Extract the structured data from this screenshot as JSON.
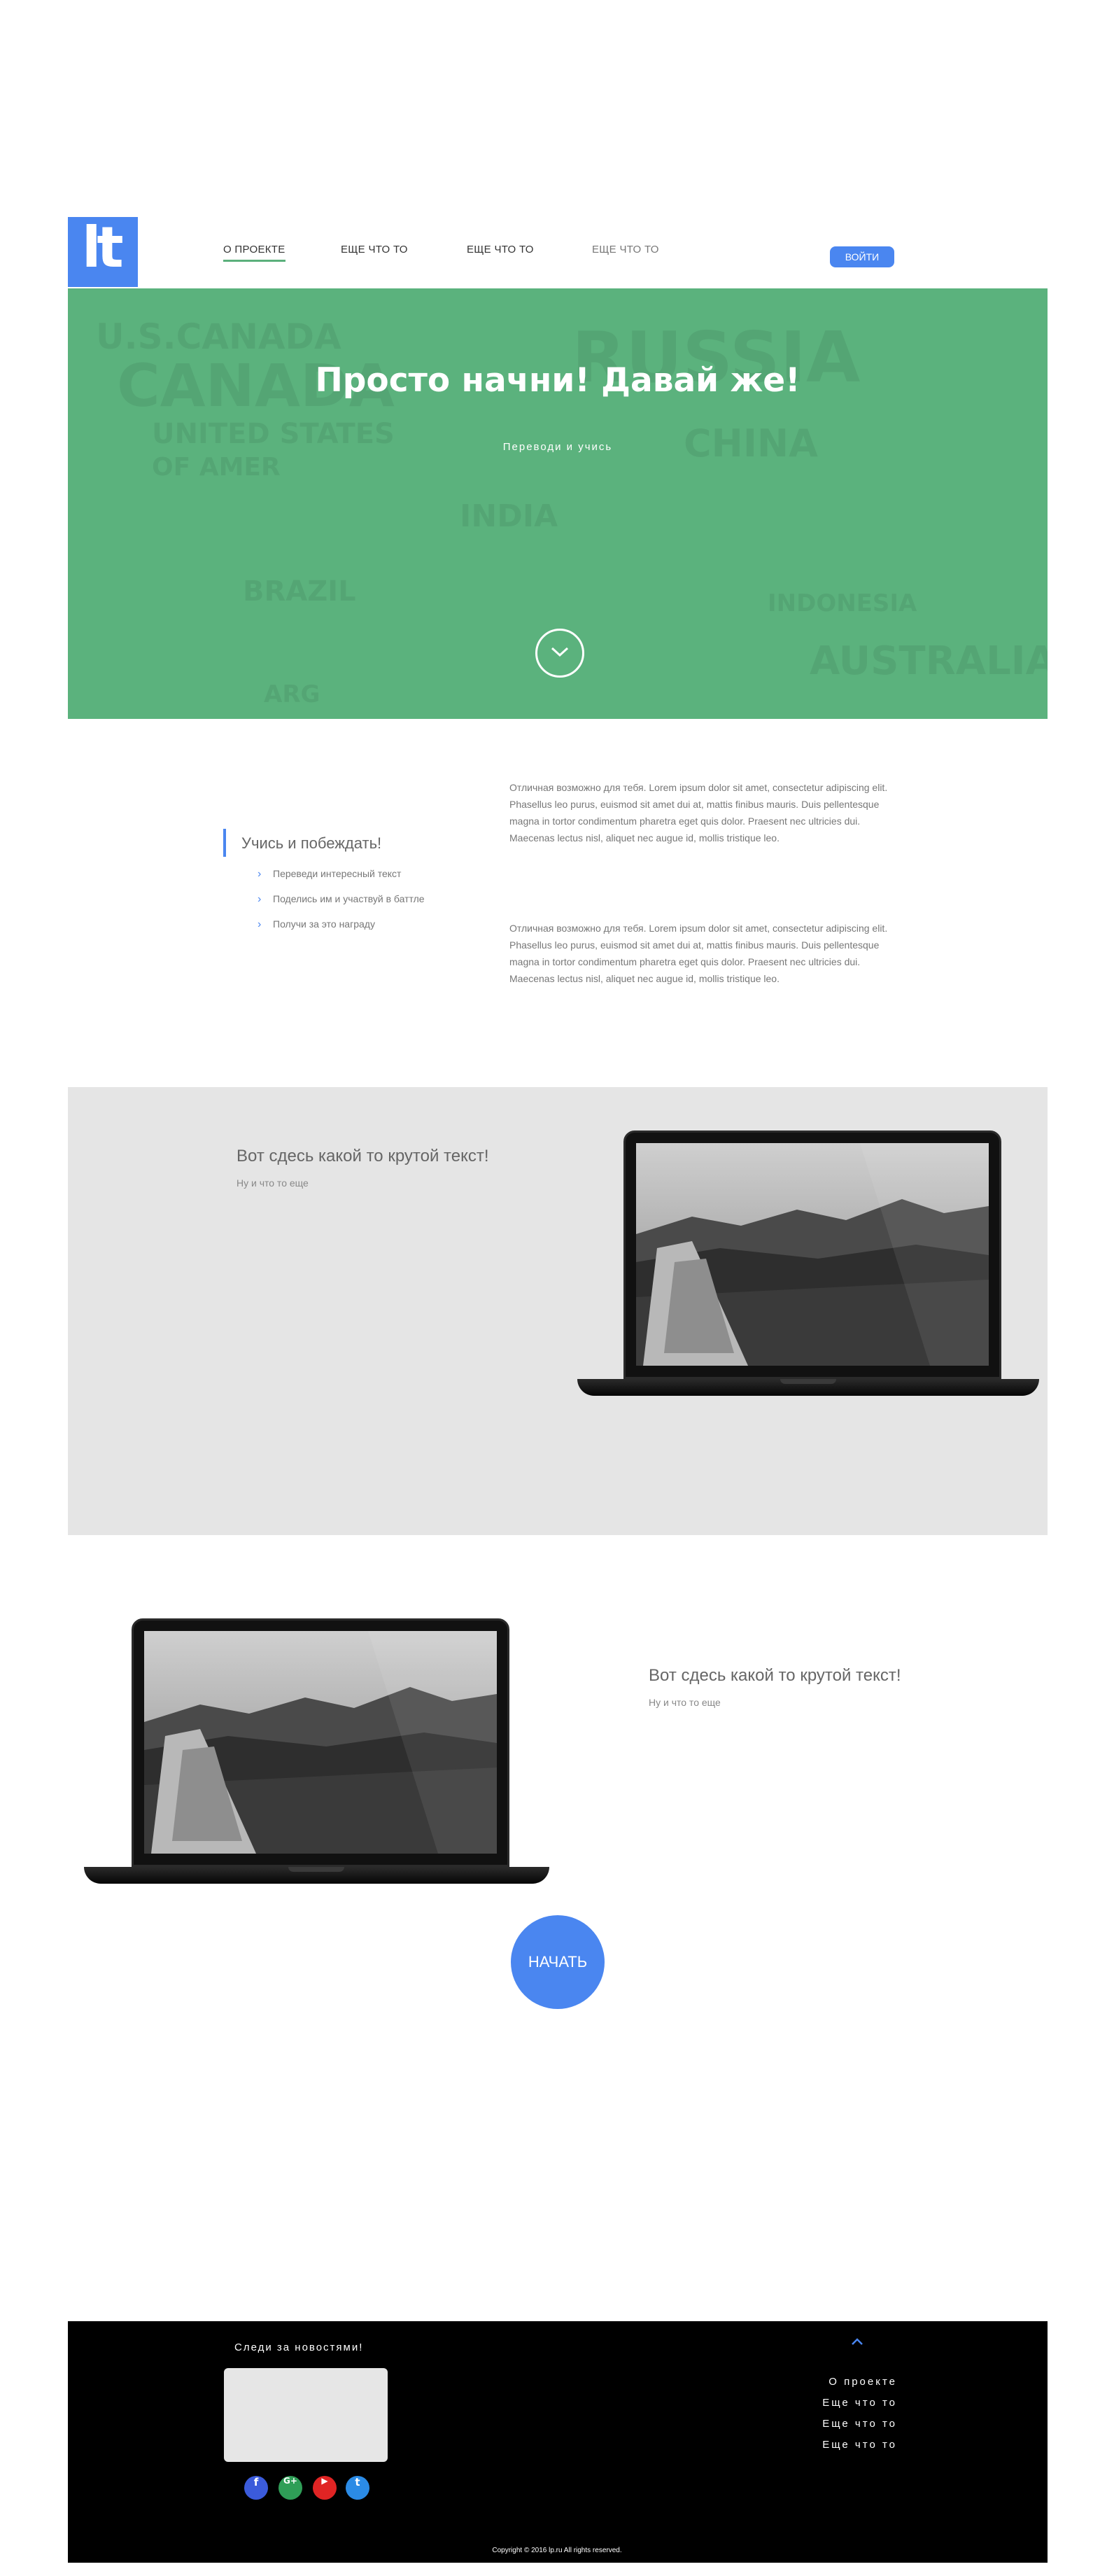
{
  "logo": {
    "text": "lt"
  },
  "nav": {
    "items": [
      "О ПРОЕКТЕ",
      "ЕЩЕ ЧТО ТО",
      "ЕЩЕ ЧТО ТО",
      "ЕЩЕ ЧТО ТО"
    ],
    "login_label": "ВОЙТИ"
  },
  "hero": {
    "title": "Просто начни! Давай же!",
    "subtitle": "Переводи и учись",
    "background_words": [
      "U.S.CANADA",
      "CANADA",
      "UNITED STATES",
      "OF AMER",
      "RUSSIA",
      "CHINA",
      "BRAZIL",
      "INDONESIA",
      "AUSTRALIA",
      "INDIA",
      "ARG"
    ],
    "down_icon": "chevron-down-icon"
  },
  "learn": {
    "title": "Учись и побеждать!",
    "items": [
      "Переведи интересный текст",
      "Поделись им и участвуй в баттле",
      "Получи за это награду"
    ]
  },
  "paragraphs": [
    "Отличная возможно для тебя. Lorem ipsum dolor sit amet, consectetur adipiscing elit. Phasellus leo purus, euismod sit amet dui at, mattis finibus mauris. Duis pellentesque magna in tortor condimentum pharetra eget quis dolor. Praesent nec ultricies dui. Maecenas lectus nisl, aliquet nec augue id, mollis tristique leo.",
    "Отличная возможно для тебя. Lorem ipsum dolor sit amet, consectetur adipiscing elit. Phasellus leo purus, euismod sit amet dui at, mattis finibus mauris. Duis pellentesque magna in tortor condimentum pharetra eget quis dolor. Praesent nec ultricies dui. Maecenas lectus nisl, aliquet nec augue id, mollis tristique leo."
  ],
  "feature1": {
    "title": "Вот сдесь какой то крутой текст!",
    "subtitle": "Ну и что то еще"
  },
  "feature2": {
    "title": "Вот сдесь какой то крутой текст!",
    "subtitle": "Ну и что то еще"
  },
  "start_label": "НАЧАТЬ",
  "footer": {
    "follow": "Следи за новостями!",
    "social": [
      "f",
      "G+",
      "▶",
      "t"
    ],
    "social_icons": [
      "facebook-icon",
      "google-plus-icon",
      "youtube-icon",
      "twitter-icon"
    ],
    "links": [
      "О проекте",
      "Еще что то",
      "Еще что то",
      "Еще что то"
    ],
    "copyright": "Copyright © 2016 lp.ru All rights reserved."
  },
  "colors": {
    "accent": "#4a86f0",
    "hero": "#5bb27d",
    "grey": "#e5e5e5",
    "footer": "#000000"
  }
}
